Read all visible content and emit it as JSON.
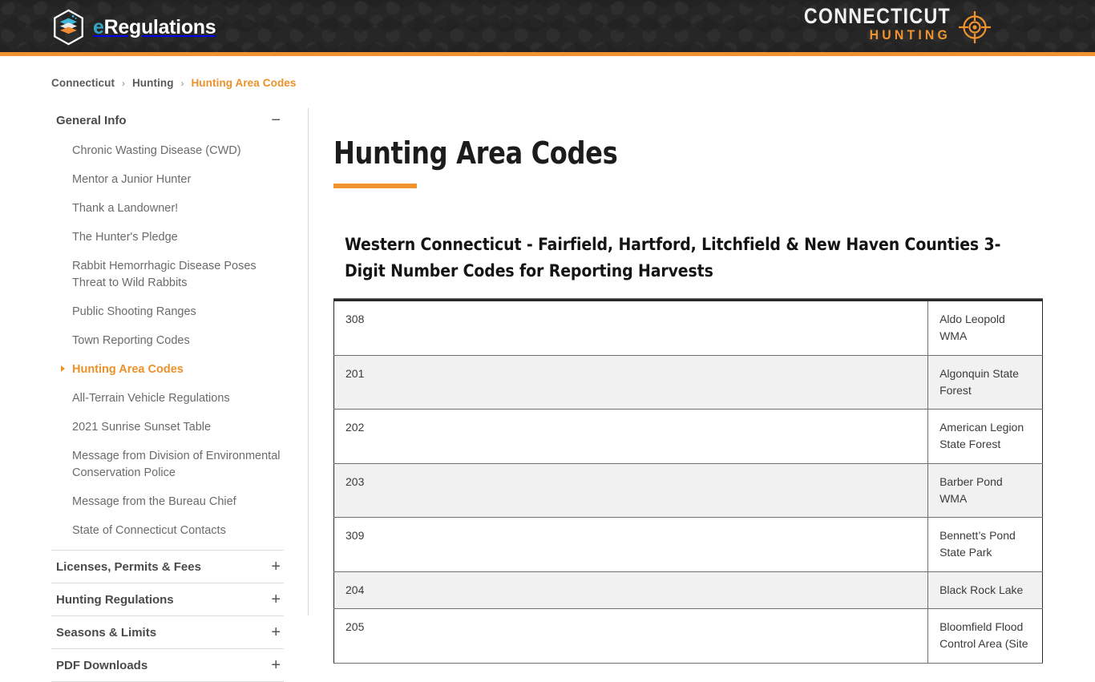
{
  "header": {
    "logo_icon": "eregulations-hexagon-book-logo",
    "brand_e": "e",
    "brand_rest": "Regulations",
    "state_line": "CONNECTICUT",
    "section_line": "HUNTING",
    "target_icon": "crosshair-target-icon",
    "accent_color": "#f0932f",
    "background_color": "#262626"
  },
  "breadcrumb": {
    "items": [
      {
        "label": "Connecticut",
        "current": false
      },
      {
        "label": "Hunting",
        "current": false
      },
      {
        "label": "Hunting Area Codes",
        "current": true
      }
    ],
    "separator": "›"
  },
  "sidebar": {
    "sections": [
      {
        "label": "General Info",
        "toggle": "−",
        "expanded": true,
        "items": [
          {
            "label": "Chronic Wasting Disease (CWD)",
            "active": false
          },
          {
            "label": "Mentor a Junior Hunter",
            "active": false
          },
          {
            "label": "Thank a Landowner!",
            "active": false
          },
          {
            "label": "The Hunter's Pledge",
            "active": false
          },
          {
            "label": "Rabbit Hemorrhagic Disease Poses Threat to Wild Rabbits",
            "active": false
          },
          {
            "label": "Public Shooting Ranges",
            "active": false
          },
          {
            "label": "Town Reporting Codes",
            "active": false
          },
          {
            "label": "Hunting Area Codes",
            "active": true
          },
          {
            "label": "All-Terrain Vehicle Regulations",
            "active": false
          },
          {
            "label": "2021 Sunrise Sunset Table",
            "active": false
          },
          {
            "label": "Message from Division of Environmental Conservation Police",
            "active": false
          },
          {
            "label": "Message from the Bureau Chief",
            "active": false
          },
          {
            "label": "State of Connecticut Contacts",
            "active": false
          }
        ]
      },
      {
        "label": "Licenses, Permits & Fees",
        "toggle": "+",
        "expanded": false,
        "items": []
      },
      {
        "label": "Hunting Regulations",
        "toggle": "+",
        "expanded": false,
        "items": []
      },
      {
        "label": "Seasons & Limits",
        "toggle": "+",
        "expanded": false,
        "items": []
      },
      {
        "label": "PDF Downloads",
        "toggle": "+",
        "expanded": false,
        "items": []
      }
    ]
  },
  "main": {
    "title": "Hunting Area Codes",
    "table": {
      "caption": "Western Connecticut - Fairfield, Hartford, Litchfield & New Haven Counties 3-Digit Number Codes for Reporting Harvests",
      "rows": [
        {
          "code": "308",
          "area": "Aldo Leopold WMA"
        },
        {
          "code": "201",
          "area": "Algonquin State Forest"
        },
        {
          "code": "202",
          "area": "American Legion State Forest"
        },
        {
          "code": "203",
          "area": "Barber Pond WMA"
        },
        {
          "code": "309",
          "area": "Bennett’s Pond State Park"
        },
        {
          "code": "204",
          "area": "Black Rock Lake"
        },
        {
          "code": "205",
          "area": "Bloomfield Flood Control Area (Site"
        }
      ]
    }
  }
}
